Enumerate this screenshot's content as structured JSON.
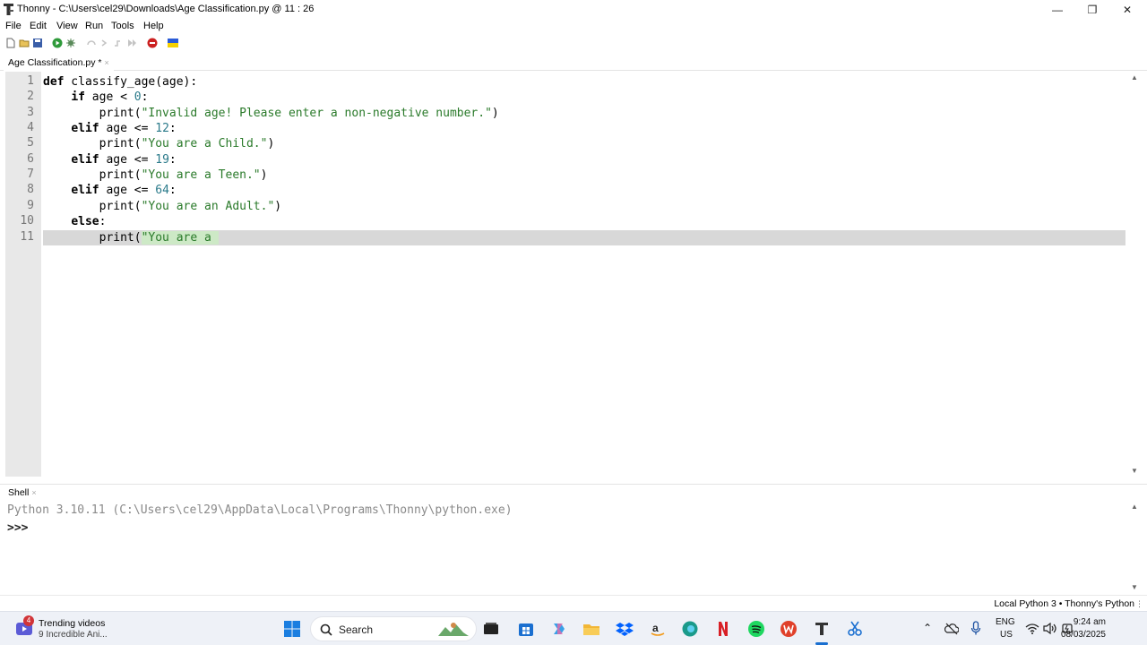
{
  "window": {
    "title": "Thonny  -  C:\\Users\\cel29\\Downloads\\Age Classification.py  @  11 : 26",
    "minimize_glyph": "—",
    "restore_glyph": "❐",
    "close_glyph": "✕"
  },
  "menu": [
    "File",
    "Edit",
    "View",
    "Run",
    "Tools",
    "Help"
  ],
  "toolbar_icons": [
    "new-file-icon",
    "open-file-icon",
    "save-icon",
    "run-icon",
    "debug-icon",
    "step-over-icon",
    "step-into-icon",
    "step-out-icon",
    "resume-icon",
    "stop-icon",
    "ukraine-flag-icon"
  ],
  "editor_tab": {
    "label": "Age Classification.py *",
    "close_glyph": "×"
  },
  "editor": {
    "line_numbers": [
      "1",
      "2",
      "3",
      "4",
      "5",
      "6",
      "7",
      "8",
      "9",
      "10",
      "11"
    ],
    "lines": [
      "def classify_age(age):",
      "    if age < 0:",
      "        print(\"Invalid age! Please enter a non-negative number.\")",
      "    elif age <= 12:",
      "        print(\"You are a Child.\")",
      "    elif age <= 19:",
      "        print(\"You are a Teen.\")",
      "    elif age <= 64:",
      "        print(\"You are an Adult.\")",
      "    else:",
      "        print(\"You are a "
    ],
    "current_line": 11
  },
  "shell": {
    "tab_label": "Shell",
    "close_glyph": "×",
    "banner": "Python 3.10.11 (C:\\Users\\cel29\\AppData\\Local\\Programs\\Thonny\\python.exe)",
    "prompt": ">>>"
  },
  "status": {
    "interpreter": "Local Python 3  •  Thonny's Python"
  },
  "taskbar": {
    "widget_badge": "4",
    "widget_title": "Trending videos",
    "widget_subtitle": "9 Incredible Ani...",
    "search_label": "Search",
    "language_top": "ENG",
    "language_bottom": "US",
    "time": "9:24 am",
    "date": "08/03/2025"
  },
  "colors": {
    "keyword": "#000000",
    "number": "#2a7a8a",
    "string": "#2a7a2a",
    "string_highlight": "#cde9c6",
    "current_line": "#d8d8d8",
    "gutter": "#e8e8e8",
    "taskbar": "#eef1f7"
  }
}
